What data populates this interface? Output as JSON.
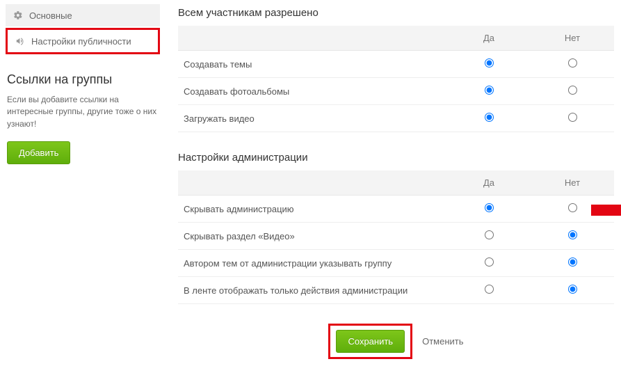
{
  "sidebar": {
    "nav": {
      "basic": "Основные",
      "publicity": "Настройки публичности"
    },
    "links": {
      "heading": "Ссылки на группы",
      "desc": "Если вы добавите ссылки на интересные группы, другие тоже о них узнают!",
      "add_btn": "Добавить"
    }
  },
  "main": {
    "section1_title": "Всем участникам разрешено",
    "section2_title": "Настройки администрации",
    "col_yes": "Да",
    "col_no": "Нет",
    "table1": [
      {
        "label": "Создавать темы",
        "value": "yes"
      },
      {
        "label": "Создавать фотоальбомы",
        "value": "yes"
      },
      {
        "label": "Загружать видео",
        "value": "yes"
      }
    ],
    "table2": [
      {
        "label": "Скрывать администрацию",
        "value": "yes"
      },
      {
        "label": "Скрывать раздел «Видео»",
        "value": "no"
      },
      {
        "label": "Автором тем от администрации указывать группу",
        "value": "no"
      },
      {
        "label": "В ленте отображать только действия администрации",
        "value": "no"
      }
    ],
    "save_btn": "Сохранить",
    "cancel": "Отменить"
  }
}
